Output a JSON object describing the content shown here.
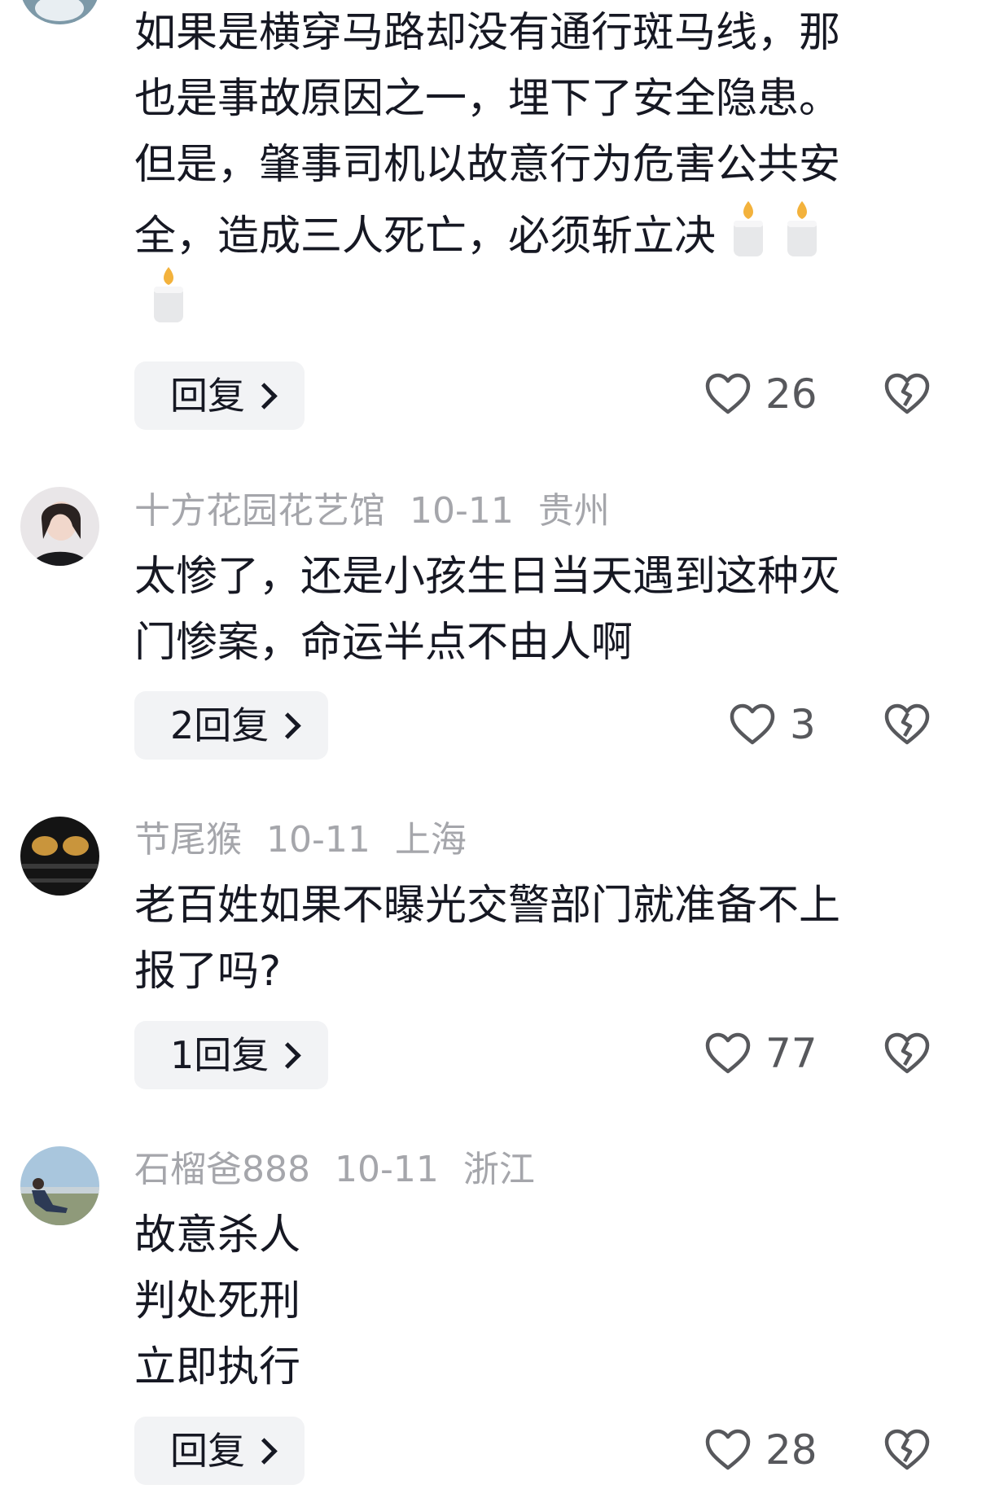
{
  "comments": [
    {
      "lines": [
        "如果是横穿马路却没有通行斑马线，那",
        "也是事故原因之一，埋下了安全隐患。",
        "但是，肇事司机以故意行为危害公共安",
        "全，造成三人死亡，必须斩立决"
      ],
      "emoji_icon": "candle-icon",
      "reply_label": "回复",
      "likes": "26"
    },
    {
      "username": "十方花园花艺馆",
      "date": "10-11",
      "location": "贵州",
      "lines": [
        "太惨了，还是小孩生日当天遇到这种灭",
        "门惨案，命运半点不由人啊"
      ],
      "reply_label": "2回复",
      "likes": "3"
    },
    {
      "username": "节尾猴",
      "date": "10-11",
      "location": "上海",
      "lines": [
        "老百姓如果不曝光交警部门就准备不上",
        "报了吗?"
      ],
      "reply_label": "1回复",
      "likes": "77"
    },
    {
      "username": "石榴爸888",
      "date": "10-11",
      "location": "浙江",
      "lines": [
        "故意杀人",
        "判处死刑",
        "立即执行"
      ],
      "reply_label": "回复",
      "likes": "28"
    }
  ],
  "colors": {
    "meta": "#a5a6ab",
    "text": "#161823",
    "button_bg": "#f2f3f5"
  }
}
